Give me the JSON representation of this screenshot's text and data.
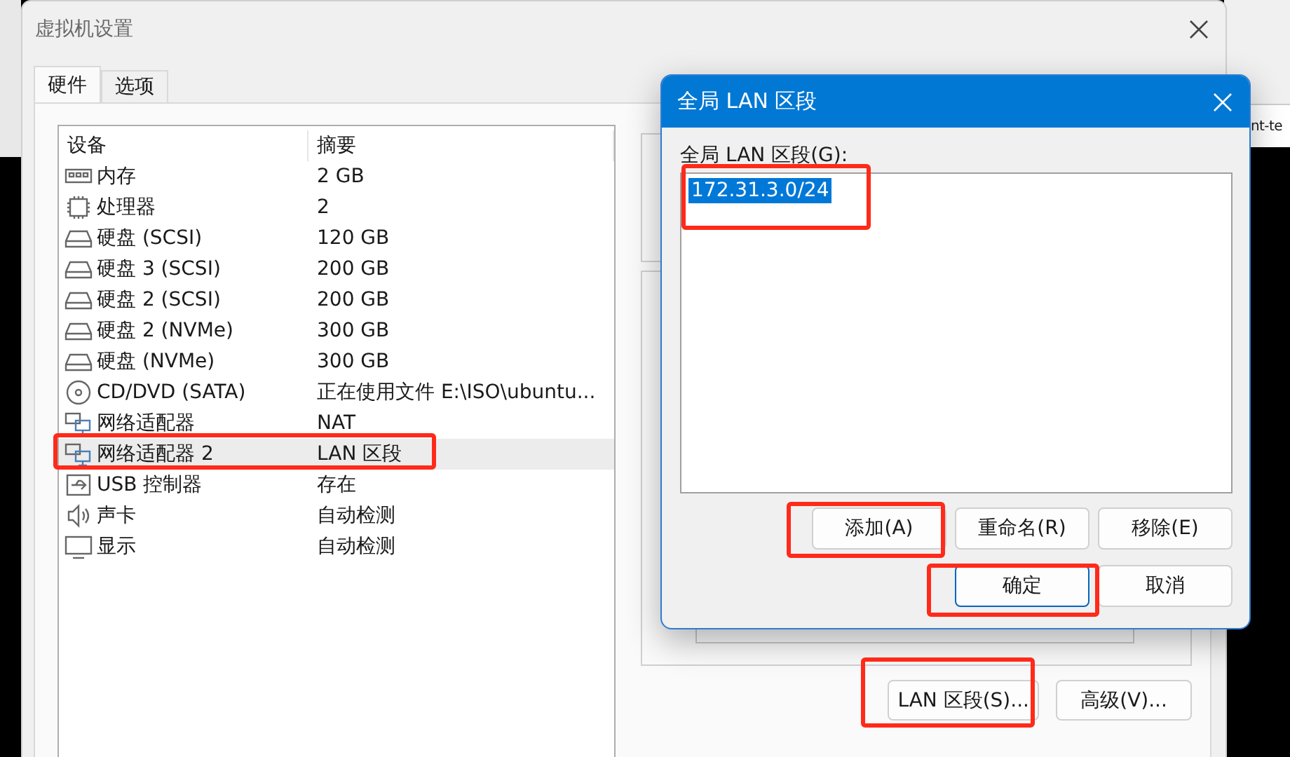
{
  "background_window": {
    "tab_text": "nt-te"
  },
  "window": {
    "title": "虚拟机设置"
  },
  "tabs": [
    {
      "label": "硬件",
      "selected": true
    },
    {
      "label": "选项",
      "selected": false
    }
  ],
  "device_table": {
    "columns": [
      "设备",
      "摘要"
    ],
    "rows": [
      {
        "kind": "memory",
        "device": "内存",
        "summary": "2 GB",
        "selected": false
      },
      {
        "kind": "cpu",
        "device": "处理器",
        "summary": "2",
        "selected": false
      },
      {
        "kind": "disk",
        "device": "硬盘 (SCSI)",
        "summary": "120 GB",
        "selected": false
      },
      {
        "kind": "disk",
        "device": "硬盘 3 (SCSI)",
        "summary": "200 GB",
        "selected": false
      },
      {
        "kind": "disk",
        "device": "硬盘 2 (SCSI)",
        "summary": "200 GB",
        "selected": false
      },
      {
        "kind": "disk",
        "device": "硬盘 2 (NVMe)",
        "summary": "300 GB",
        "selected": false
      },
      {
        "kind": "disk",
        "device": "硬盘 (NVMe)",
        "summary": "300 GB",
        "selected": false
      },
      {
        "kind": "cd",
        "device": "CD/DVD (SATA)",
        "summary": "正在使用文件 E:\\ISO\\ubuntu...",
        "selected": false
      },
      {
        "kind": "network",
        "device": "网络适配器",
        "summary": "NAT",
        "selected": false
      },
      {
        "kind": "network",
        "device": "网络适配器 2",
        "summary": "LAN 区段",
        "selected": true
      },
      {
        "kind": "usb",
        "device": "USB 控制器",
        "summary": "存在",
        "selected": false
      },
      {
        "kind": "sound",
        "device": "声卡",
        "summary": "自动检测",
        "selected": false
      },
      {
        "kind": "display",
        "device": "显示",
        "summary": "自动检测",
        "selected": false
      }
    ]
  },
  "window_buttons": [
    "LAN 区段(S)...",
    "高级(V)..."
  ],
  "dialog": {
    "title": "全局 LAN 区段",
    "list_label": "全局 LAN 区段(G):",
    "segments": [
      {
        "text": "172.31.3.0/24",
        "selected": true
      }
    ],
    "buttons": [
      {
        "label": "添加(A)",
        "default": false
      },
      {
        "label": "重命名(R)",
        "default": false
      },
      {
        "label": "移除(E)",
        "default": false
      },
      {
        "label": "确定",
        "default": true
      },
      {
        "label": "取消",
        "default": false
      }
    ]
  }
}
